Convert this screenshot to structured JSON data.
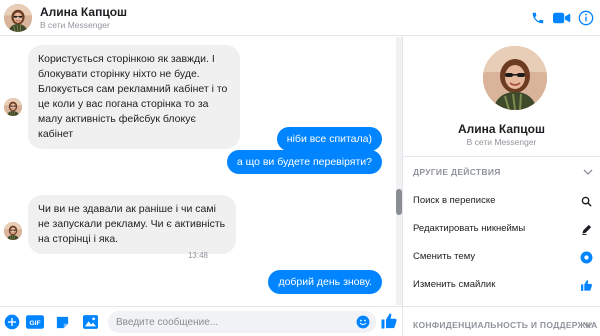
{
  "colors": {
    "accent": "#0084ff",
    "incoming_bubble": "#f0f0f0",
    "outgoing_bubble": "#0084ff",
    "muted_text": "#90949c"
  },
  "header": {
    "name": "Алина Капцош",
    "status": "В сети Messenger",
    "icons": [
      "phone-icon",
      "video-icon",
      "info-icon"
    ]
  },
  "messages": [
    {
      "direction": "incoming",
      "text": "Користується сторінкою як завжди. І блокувати сторінку ніхто не буде. Блокується сам рекламний кабінет і то це коли у вас погана сторінка то за малу активність фейсбук блокує кабінет"
    },
    {
      "direction": "outgoing",
      "text": "ніби все спитала)"
    },
    {
      "direction": "outgoing",
      "text": "а що ви будете перевіряти?"
    },
    {
      "direction": "incoming",
      "text": "Чи ви не здавали ак раніше і чи самі не запускали рекламу. Чи є активність на сторінці і яка."
    },
    {
      "direction": "timestamp",
      "text": "13:48"
    },
    {
      "direction": "outgoing",
      "text": "добрий день знову."
    }
  ],
  "composer": {
    "placeholder": "Введите сообщение...",
    "gif_label": "GIF",
    "icons": [
      "plus-icon",
      "gif-icon",
      "sticker-icon",
      "photo-icon",
      "emoji-icon",
      "like-icon"
    ]
  },
  "panel": {
    "name": "Алина Капцош",
    "status": "В сети Messenger",
    "section_other": "ДРУГИЕ ДЕЙСТВИЯ",
    "items": [
      {
        "label": "Поиск в переписке",
        "icon": "search-icon"
      },
      {
        "label": "Редактировать никнеймы",
        "icon": "pencil-icon"
      },
      {
        "label": "Сменить тему",
        "icon": "theme-icon"
      },
      {
        "label": "Изменить смайлик",
        "icon": "like-icon"
      }
    ],
    "section_privacy": "КОНФИДЕНЦИАЛЬНОСТЬ И ПОДДЕРЖКА"
  }
}
